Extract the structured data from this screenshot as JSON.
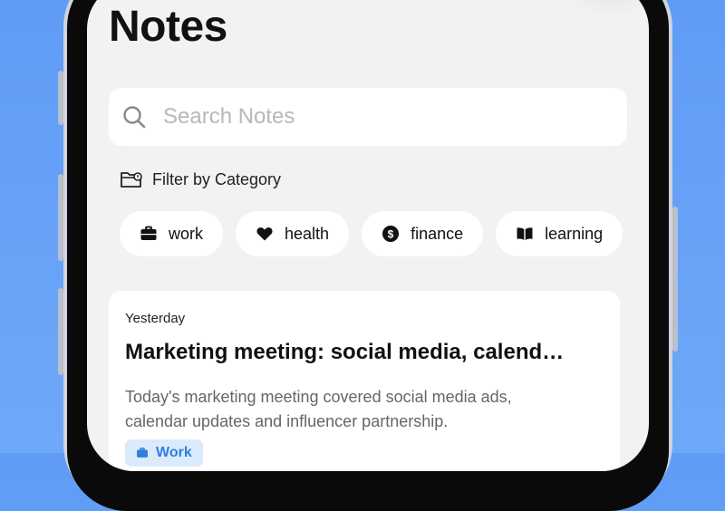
{
  "header": {
    "title": "Notes"
  },
  "search": {
    "placeholder": "Search Notes",
    "icon": "search-icon"
  },
  "filter": {
    "label": "Filter by Category",
    "icon": "folder-filter-icon"
  },
  "categories": [
    {
      "label": "work",
      "icon": "briefcase-icon"
    },
    {
      "label": "health",
      "icon": "heart-icon"
    },
    {
      "label": "finance",
      "icon": "dollar-coin-icon"
    },
    {
      "label": "learning",
      "icon": "book-icon"
    }
  ],
  "notes": [
    {
      "date": "Yesterday",
      "title": "Marketing meeting: social media, calend…",
      "body": "Today's marketing meeting covered social media ads, calendar updates and influencer partnership.",
      "tag": "Work",
      "tag_icon": "briefcase-icon"
    }
  ],
  "colors": {
    "background": "#5f9cf6",
    "screen": "#f2f2f2",
    "tag_bg": "#dcebfb",
    "tag_text": "#2f7fe0"
  }
}
